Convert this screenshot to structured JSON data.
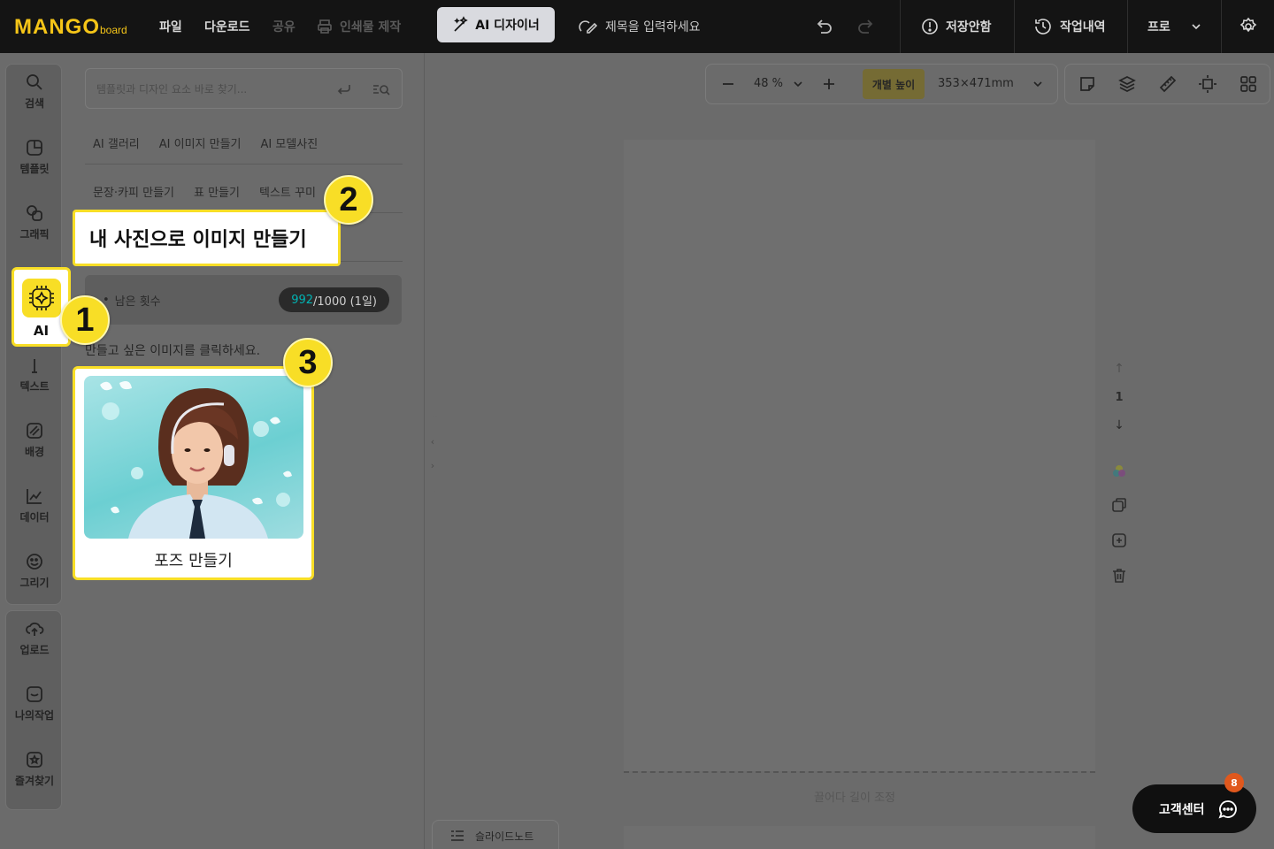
{
  "header": {
    "logo_main": "MANGO",
    "logo_sub": "board",
    "menu_file": "파일",
    "menu_download": "다운로드",
    "menu_share": "공유",
    "menu_print": "인쇄물 제작",
    "ai_designer": "AI 디자이너",
    "title_placeholder": "제목을 입력하세요",
    "unsaved": "저장안함",
    "history": "작업내역",
    "plan": "프로"
  },
  "rail": {
    "items": [
      {
        "label": "검색",
        "icon": "search-icon"
      },
      {
        "label": "템플릿",
        "icon": "template-icon"
      },
      {
        "label": "그래픽",
        "icon": "graphic-icon"
      },
      {
        "label": "AI",
        "icon": "ai-chip-icon"
      },
      {
        "label": "텍스트",
        "icon": "text-icon"
      },
      {
        "label": "배경",
        "icon": "background-icon"
      },
      {
        "label": "데이터",
        "icon": "chart-icon"
      },
      {
        "label": "그리기",
        "icon": "draw-icon"
      }
    ],
    "bottom_items": [
      {
        "label": "업로드",
        "icon": "upload-icon"
      },
      {
        "label": "나의작업",
        "icon": "my-work-icon"
      },
      {
        "label": "즐겨찾기",
        "icon": "favorite-icon"
      }
    ]
  },
  "panel": {
    "search_placeholder": "템플릿과 디자인 요소 바로 찾기...",
    "row1": [
      "AI 갤러리",
      "AI 이미지 만들기",
      "AI 모델사진"
    ],
    "row2": [
      "문장·카피 만들기",
      "표 만들기",
      "텍스트 꾸미"
    ],
    "highlight_menu": "내 사진으로 이미지 만들기",
    "remaining_label": "남은 횟수",
    "remaining_used": "992",
    "remaining_rest": "/1000 (1일)",
    "instruction": "만들고 싶은 이미지를 클릭하세요.",
    "card_label": "포즈 만들기"
  },
  "canvas": {
    "zoom": "48 %",
    "individual_height": "개별 높이",
    "size": "353×471mm",
    "resize_hint": "끌어다 길이 조정",
    "page_number": "1",
    "slide_note": "슬라이드노트"
  },
  "support": {
    "label": "고객센터",
    "badge": "8"
  },
  "steps": [
    "1",
    "2",
    "3"
  ],
  "colors": {
    "accent": "#f8de26",
    "topbar": "#141414",
    "teal": "#00b4b4",
    "badge": "#e0581d"
  }
}
